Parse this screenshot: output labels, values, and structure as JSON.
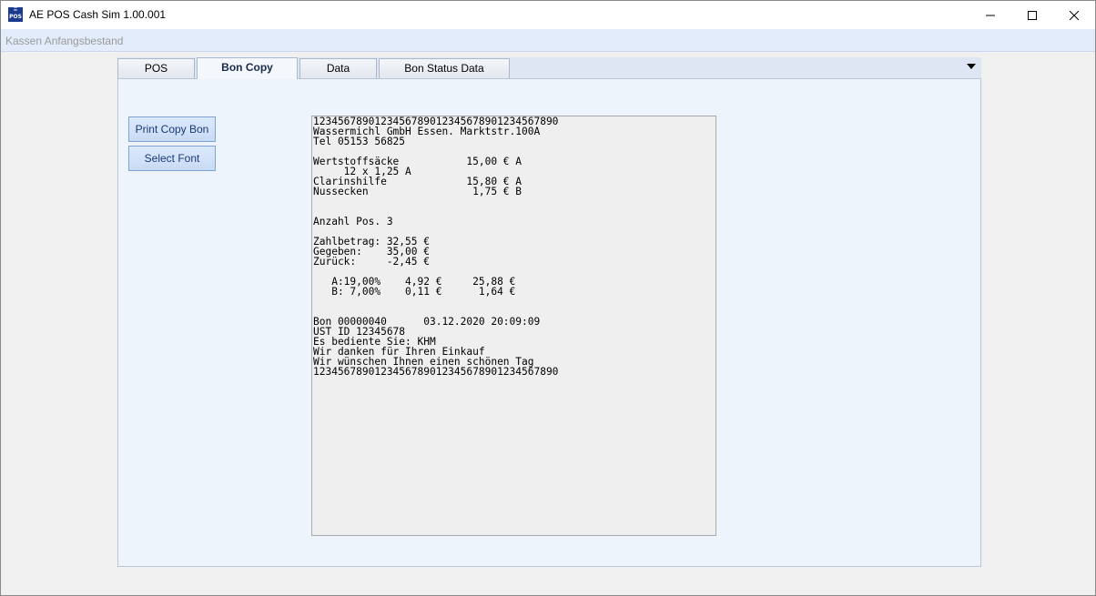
{
  "window": {
    "title": "AE POS Cash Sim 1.00.001",
    "icon_text": "POS",
    "controls": [
      "minimize-icon",
      "maximize-icon",
      "close-icon"
    ]
  },
  "menubar": {
    "items": [
      "Kassen Anfangsbestand"
    ]
  },
  "tabs": [
    {
      "label": "POS"
    },
    {
      "label": "Bon Copy",
      "active": true
    },
    {
      "label": "Data"
    },
    {
      "label": "Bon Status Data"
    }
  ],
  "buttons": {
    "print_copy_bon": "Print Copy Bon",
    "select_font": "Select Font"
  },
  "bon_lines": [
    "1234567890123456789012345678901234567890",
    "Wassermichl GmbH Essen. Marktstr.100A",
    "Tel 05153 56825",
    "",
    "Wertstoffsäcke           15,00 € A",
    "     12 x 1,25 A",
    "Clarinshilfe             15,80 € A",
    "Nussecken                 1,75 € B",
    "",
    "",
    "Anzahl Pos. 3",
    "",
    "Zahlbetrag: 32,55 €",
    "Gegeben:    35,00 €",
    "Zurück:     -2,45 €",
    "",
    "   A:19,00%    4,92 €     25,88 €",
    "   B: 7,00%    0,11 €      1,64 €",
    "",
    "",
    "Bon 00000040      03.12.2020 20:09:09",
    "UST ID 12345678",
    "Es bediente Sie: KHM",
    "Wir danken für Ihren Einkauf",
    "Wir wünschen Ihnen einen schönen Tag",
    "1234567890123456789012345678901234567890"
  ],
  "colors": {
    "accent": "#1a3a8f",
    "menubar_bg": "#e3ecfb",
    "panel_bg": "#eef4fc"
  }
}
